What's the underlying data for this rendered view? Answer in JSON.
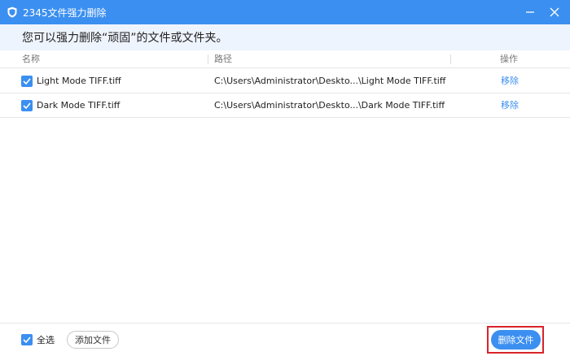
{
  "window": {
    "title": "2345文件强力删除",
    "icon": "shield-icon",
    "minimize_icon": "minimize-icon",
    "close_icon": "close-icon"
  },
  "subheader": {
    "text": "您可以强力删除“顽固”的文件或文件夹。"
  },
  "table": {
    "columns": {
      "name": "名称",
      "path": "路径",
      "action": "操作"
    },
    "rows": [
      {
        "checked": true,
        "name": "Light Mode TIFF.tiff",
        "path": "C:\\Users\\Administrator\\Deskto...\\Light Mode TIFF.tiff",
        "action": "移除"
      },
      {
        "checked": true,
        "name": "Dark Mode TIFF.tiff",
        "path": "C:\\Users\\Administrator\\Deskto...\\Dark Mode TIFF.tiff",
        "action": "移除"
      }
    ]
  },
  "footer": {
    "select_all_checked": true,
    "select_all_label": "全选",
    "add_file_label": "添加文件",
    "delete_file_label": "删除文件"
  },
  "colors": {
    "accent": "#3b8ff0",
    "subheader_bg": "#eef4fd",
    "highlight_border": "#d9232a"
  }
}
